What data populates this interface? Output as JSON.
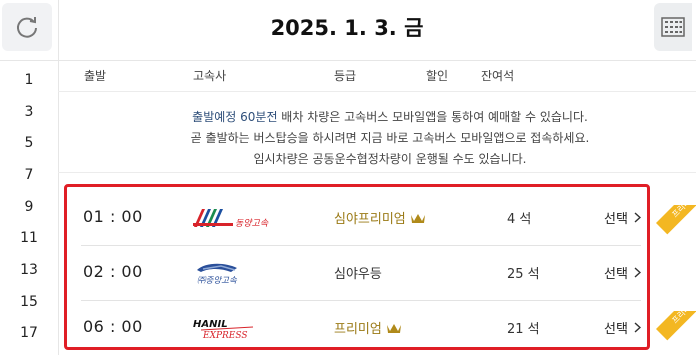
{
  "header": {
    "date": "2025. 1. 3. 금"
  },
  "line_numbers": [
    "1",
    "3",
    "5",
    "7",
    "9",
    "11",
    "13",
    "15",
    "17"
  ],
  "columns": {
    "departure": "출발",
    "company": "고속사",
    "grade": "등급",
    "discount": "할인",
    "seats": "잔여석"
  },
  "notice": {
    "line1_highlight": "출발예정 60분전",
    "line1_rest": " 배차 차량은 고속버스 모바일앱을 통하여 예매할 수 있습니다.",
    "line2": "곧 출발하는 버스탑승을 하시려면 지금 바로 고속버스 모바일앱으로 접속하세요.",
    "line3": "임시차량은 공동운수협정차량이 운행될 수도 있습니다."
  },
  "schedules": [
    {
      "time": "01 : 00",
      "company_logo": "동양고속",
      "grade": "심야프리미엄",
      "seats": "4 석",
      "select": "선택",
      "ribbon": "프리미엄",
      "crown": true
    },
    {
      "time": "02 : 00",
      "company_logo": "㈜중앙고속",
      "grade": "심야우등",
      "seats": "25 석",
      "select": "선택",
      "ribbon": "",
      "crown": false
    },
    {
      "time": "06 : 00",
      "company_logo": "HANIL EXPRESS",
      "grade": "프리미엄",
      "seats": "21 석",
      "select": "선택",
      "ribbon": "프리미엄",
      "crown": true
    }
  ],
  "colors": {
    "highlight_box": "#e01e26",
    "premium_text": "#9a7a16",
    "ribbon": "#f3b722"
  }
}
